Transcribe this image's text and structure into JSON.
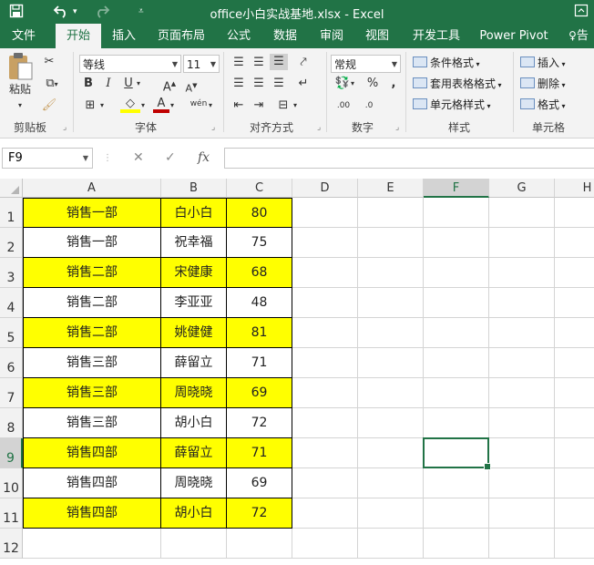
{
  "titlebar": {
    "title": "office小白实战基地.xlsx - Excel",
    "save_icon": "save-icon",
    "undo_icon": "undo-icon",
    "redo_icon": "redo-icon"
  },
  "tabs": [
    {
      "label": "文件",
      "active": false
    },
    {
      "label": "开始",
      "active": true
    },
    {
      "label": "插入",
      "active": false
    },
    {
      "label": "页面布局",
      "active": false
    },
    {
      "label": "公式",
      "active": false
    },
    {
      "label": "数据",
      "active": false
    },
    {
      "label": "审阅",
      "active": false
    },
    {
      "label": "视图",
      "active": false
    },
    {
      "label": "开发工具",
      "active": false
    },
    {
      "label": "Power Pivot",
      "active": false
    },
    {
      "label": "告",
      "active": false
    }
  ],
  "ribbon": {
    "clipboard": {
      "group_label": "剪贴板",
      "paste_label": "粘贴"
    },
    "font": {
      "group_label": "字体",
      "font_name": "等线",
      "font_size": "11",
      "bold": "B",
      "italic": "I",
      "underline": "U",
      "grow": "A",
      "shrink": "A",
      "font_color": "A",
      "phonetic": "wén"
    },
    "alignment": {
      "group_label": "对齐方式"
    },
    "number": {
      "group_label": "数字",
      "format": "常规",
      "percent": "%",
      "comma": ",",
      "inc_decimal": ".00",
      "dec_decimal": ".0"
    },
    "styles": {
      "group_label": "样式",
      "conditional_format": "条件格式",
      "format_as_table": "套用表格格式",
      "cell_styles": "单元格样式"
    },
    "cells": {
      "group_label": "单元格",
      "insert": "插入",
      "delete": "删除",
      "format": "格式"
    }
  },
  "formula_bar": {
    "name_box": "F9",
    "fx_label": "fx",
    "value": ""
  },
  "columns": [
    "A",
    "B",
    "C",
    "D",
    "E",
    "F",
    "G",
    "H"
  ],
  "selected_cell": {
    "col": "F",
    "row": "9"
  },
  "rows": [
    {
      "num": "1",
      "a": "销售一部",
      "b": "白小白",
      "c": "80",
      "highlight": true
    },
    {
      "num": "2",
      "a": "销售一部",
      "b": "祝幸福",
      "c": "75",
      "highlight": false
    },
    {
      "num": "3",
      "a": "销售二部",
      "b": "宋健康",
      "c": "68",
      "highlight": true
    },
    {
      "num": "4",
      "a": "销售二部",
      "b": "李亚亚",
      "c": "48",
      "highlight": false
    },
    {
      "num": "5",
      "a": "销售二部",
      "b": "姚健健",
      "c": "81",
      "highlight": true
    },
    {
      "num": "6",
      "a": "销售三部",
      "b": "薛留立",
      "c": "71",
      "highlight": false
    },
    {
      "num": "7",
      "a": "销售三部",
      "b": "周晓晓",
      "c": "69",
      "highlight": true
    },
    {
      "num": "8",
      "a": "销售三部",
      "b": "胡小白",
      "c": "72",
      "highlight": false
    },
    {
      "num": "9",
      "a": "销售四部",
      "b": "薛留立",
      "c": "71",
      "highlight": true
    },
    {
      "num": "10",
      "a": "销售四部",
      "b": "周晓晓",
      "c": "69",
      "highlight": false
    },
    {
      "num": "11",
      "a": "销售四部",
      "b": "胡小白",
      "c": "72",
      "highlight": true
    },
    {
      "num": "12",
      "a": "",
      "b": "",
      "c": "",
      "highlight": false
    }
  ],
  "colors": {
    "accent": "#217346",
    "highlight": "#ffff00"
  }
}
